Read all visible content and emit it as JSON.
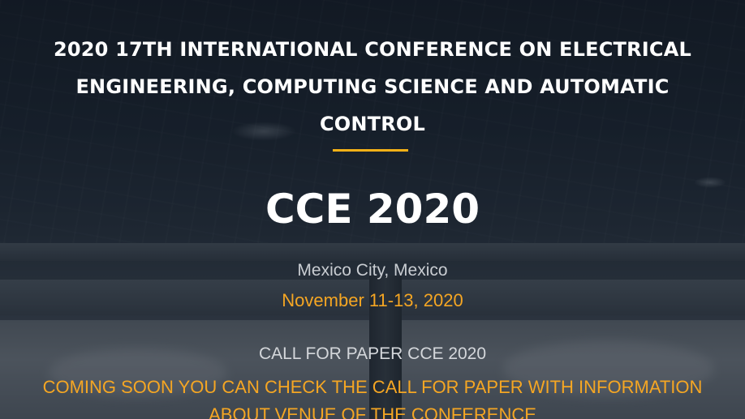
{
  "hero": {
    "conference_title": "2020 17TH INTERNATIONAL CONFERENCE ON ELECTRICAL ENGINEERING, COMPUTING SCIENCE AND AUTOMATIC CONTROL",
    "acronym": "CCE 2020",
    "location": "Mexico City, Mexico",
    "dates": "November 11-13, 2020",
    "cfp_heading": "CALL FOR PAPER CCE 2020",
    "cfp_notice": "COMING SOON YOU CAN CHECK THE CALL FOR PAPER WITH INFORMATION ABOUT VENUE OF THE CONFERENCE"
  },
  "colors": {
    "accent": "#f5a623",
    "divider": "#f5b117",
    "title_text": "#ffffff",
    "muted_text": "#c9cdd2"
  }
}
